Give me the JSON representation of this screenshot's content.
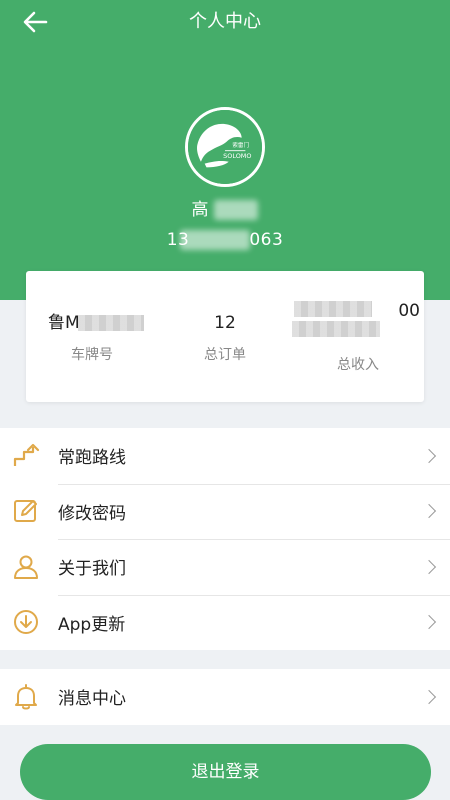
{
  "header": {
    "title": "个人中心",
    "user_name": "高",
    "user_phone": "13",
    "user_phone_tail": "063"
  },
  "avatar": {
    "brand_text_cn": "索雷门",
    "brand_text_en": "SOLOMO"
  },
  "stats": {
    "plate": {
      "value": "鲁M",
      "label": "车牌号"
    },
    "orders": {
      "value": "12",
      "label": "总订单"
    },
    "income": {
      "value": "00",
      "label": "总收入"
    }
  },
  "menu": {
    "items": [
      {
        "label": "常跑路线",
        "icon": "route-icon"
      },
      {
        "label": "修改密码",
        "icon": "edit-password-icon"
      },
      {
        "label": "关于我们",
        "icon": "user-icon"
      },
      {
        "label": "App更新",
        "icon": "download-icon"
      }
    ],
    "messages": {
      "label": "消息中心",
      "icon": "bell-icon"
    }
  },
  "logout": {
    "label": "退出登录"
  },
  "colors": {
    "brand": "#45ad6a",
    "icon_accent": "#e0a94a"
  }
}
